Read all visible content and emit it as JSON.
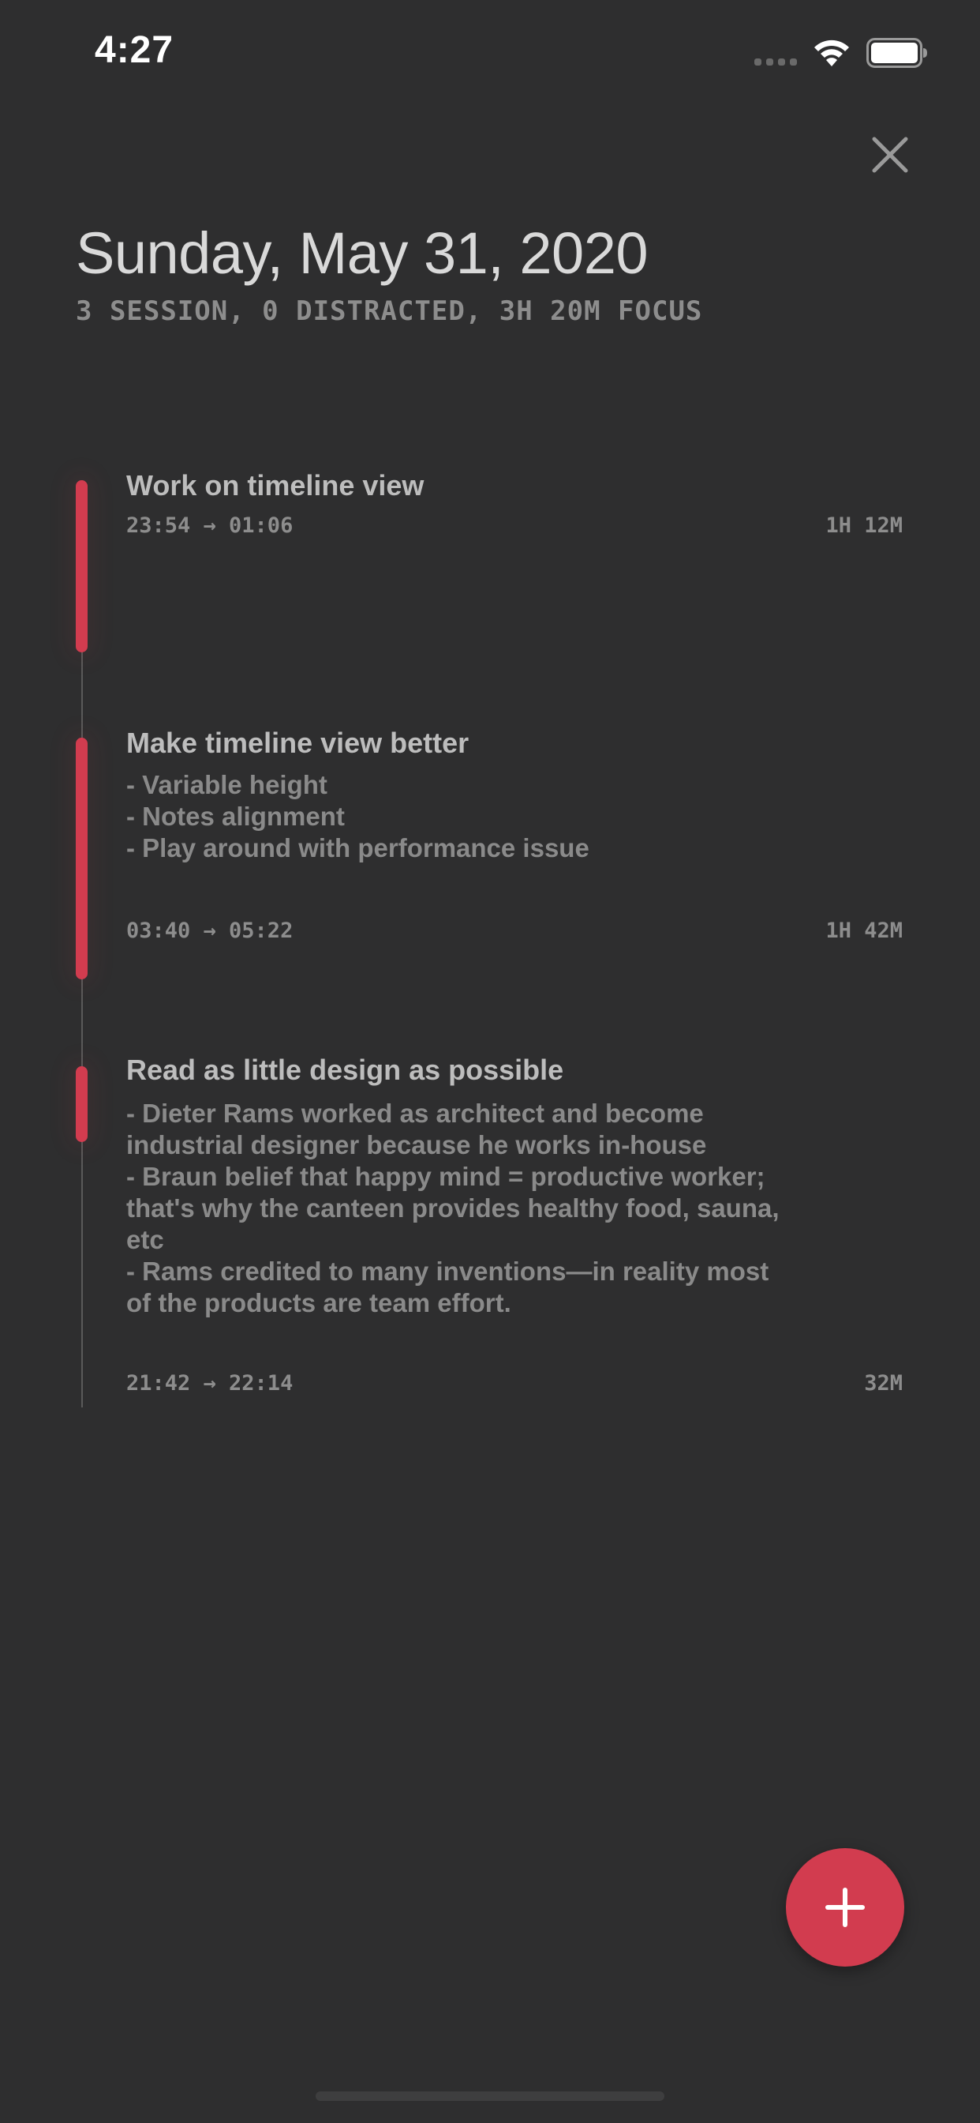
{
  "status_bar": {
    "time": "4:27"
  },
  "header": {
    "title": "Sunday, May 31, 2020",
    "summary": "3 SESSION, 0 DISTRACTED, 3H 20M FOCUS"
  },
  "sessions": [
    {
      "title": "Work on timeline view",
      "notes": [],
      "time_range": "23:54 → 01:06",
      "duration": "1H 12M"
    },
    {
      "title": "Make timeline view better",
      "notes": [
        "- Variable height",
        "- Notes alignment",
        "- Play around with performance issue"
      ],
      "time_range": "03:40 → 05:22",
      "duration": "1H 42M"
    },
    {
      "title": "Read as little design as possible",
      "notes": [
        "- Dieter Rams worked as architect and become",
        "industrial designer because he works in-house",
        "- Braun belief that happy mind = productive worker;",
        "that's why the canteen provides healthy food, sauna,",
        "etc",
        "- Rams credited to many inventions—in reality most",
        "of the products are team effort."
      ],
      "time_range": "21:42 → 22:14",
      "duration": "32M"
    }
  ],
  "icons": {
    "close": "close-icon",
    "add": "plus-icon",
    "wifi": "wifi-icon",
    "battery": "battery-icon"
  },
  "colors": {
    "background": "#2e2e2f",
    "accent": "#d23c4f",
    "timeline": "#5a5a5a"
  }
}
